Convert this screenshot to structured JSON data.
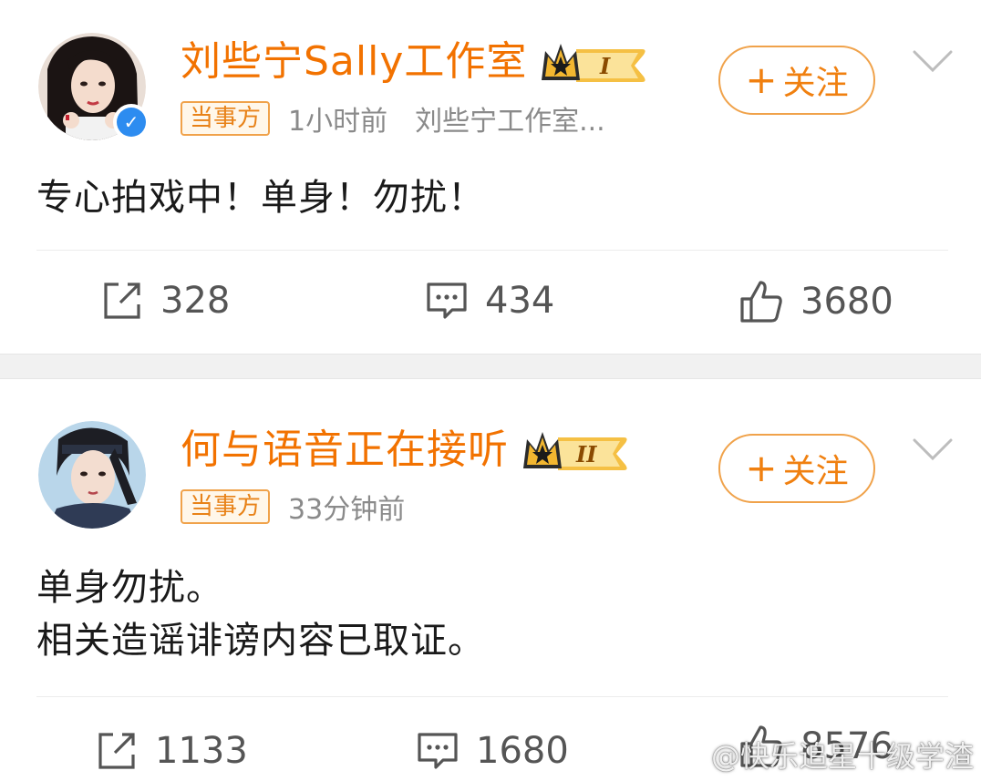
{
  "posts": [
    {
      "username": "刘些宁Sally工作室",
      "vip_level": "I",
      "party_tag": "当事方",
      "time": "1小时前",
      "source": "刘些宁工作室...",
      "follow_label": "关注",
      "content_lines": [
        "专心拍戏中！单身！勿扰！"
      ],
      "reposts": "328",
      "comments": "434",
      "likes": "3680",
      "verified": true
    },
    {
      "username": "何与语音正在接听",
      "vip_level": "II",
      "party_tag": "当事方",
      "time": "33分钟前",
      "source": "",
      "follow_label": "关注",
      "content_lines": [
        "单身勿扰。",
        "相关造谣诽谤内容已取证。"
      ],
      "reposts": "1133",
      "comments": "1680",
      "likes": "8576",
      "verified": false
    }
  ],
  "watermark": "@快乐追星十级学渣",
  "colors": {
    "accent_orange": "#f27200",
    "tag_border": "#f0a24a",
    "meta_gray": "#8a8a8a",
    "verified_blue": "#2d8cf0",
    "separator": "#f1f1f1"
  },
  "icons": {
    "repost": "repost-icon",
    "comment": "comment-icon",
    "like": "like-icon",
    "chevron": "chevron-down-icon",
    "crown": "crown-icon",
    "verified": "verified-icon"
  }
}
